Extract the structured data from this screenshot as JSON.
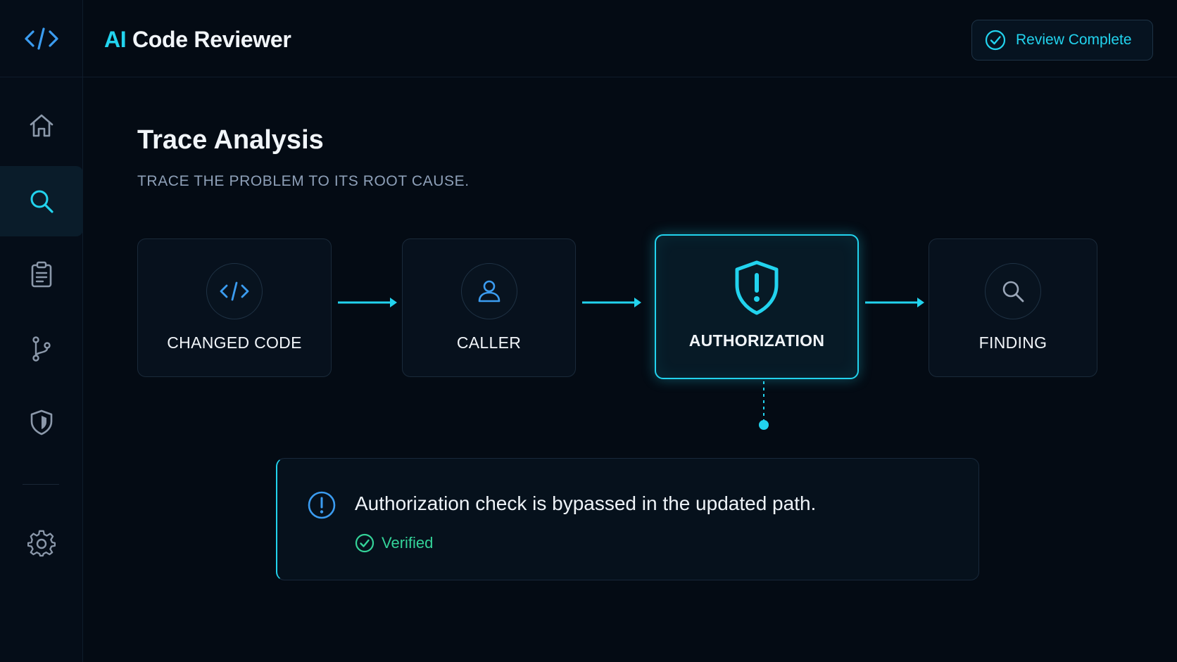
{
  "app": {
    "title_prefix": "AI",
    "title_rest": "Code Reviewer",
    "status_button": "Review Complete"
  },
  "sidebar": {
    "items": [
      {
        "id": "home",
        "icon": "home-icon"
      },
      {
        "id": "search",
        "icon": "search-icon",
        "active": true
      },
      {
        "id": "clipboard",
        "icon": "clipboard-icon"
      },
      {
        "id": "branch",
        "icon": "git-branch-icon"
      },
      {
        "id": "security",
        "icon": "shield-icon"
      },
      {
        "id": "settings",
        "icon": "gear-icon"
      }
    ]
  },
  "page": {
    "title": "Trace Analysis",
    "subtitle": "TRACE THE PROBLEM TO ITS ROOT CAUSE."
  },
  "trace": {
    "steps": [
      {
        "label": "CHANGED CODE",
        "icon": "code-icon"
      },
      {
        "label": "CALLER",
        "icon": "user-icon"
      },
      {
        "label": "AUTHORIZATION",
        "icon": "shield-alert-icon",
        "highlighted": true
      },
      {
        "label": "FINDING",
        "icon": "search-icon"
      }
    ]
  },
  "finding": {
    "text": "Authorization check is bypassed in the updated path.",
    "status": "Verified"
  },
  "colors": {
    "accent": "#22d3ee",
    "success": "#34d399",
    "background": "#040b14",
    "info_blue": "#3b9cf0"
  }
}
